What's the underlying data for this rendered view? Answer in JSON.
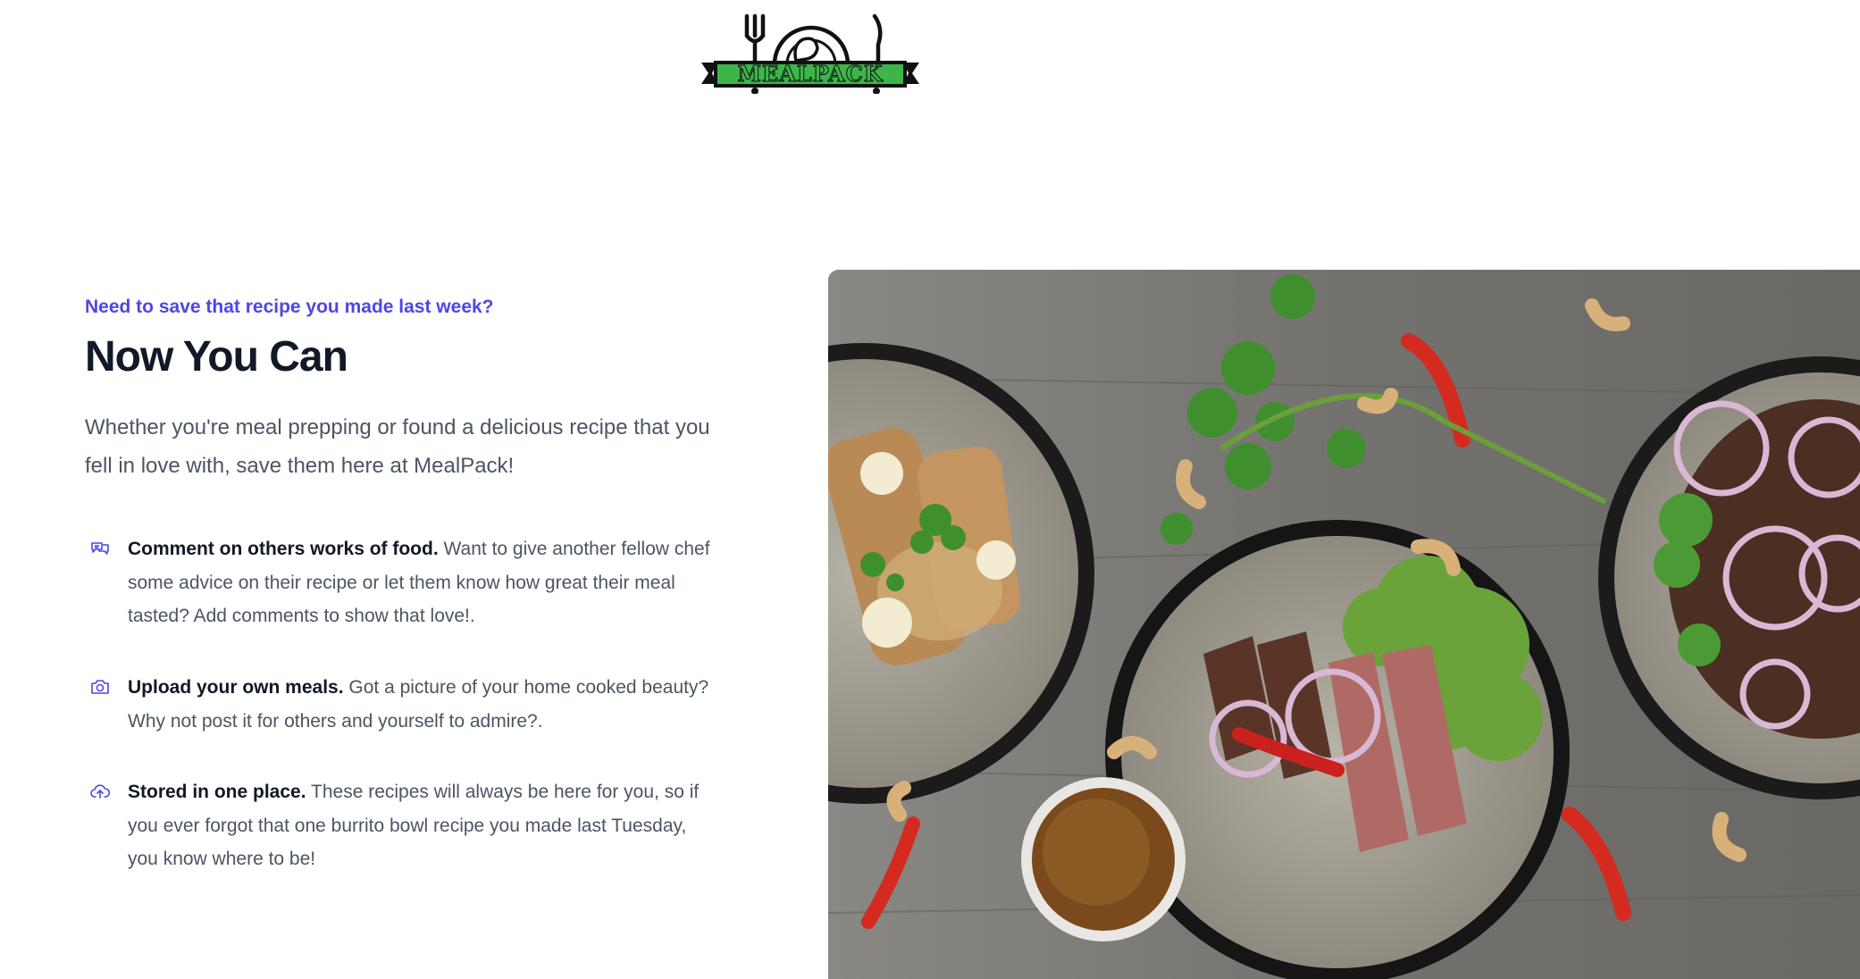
{
  "brand": {
    "name": "MEALPACK"
  },
  "hero": {
    "eyebrow": "Need to save that recipe you made last week?",
    "title": "Now You Can",
    "lead": "Whether you're meal prepping or found a delicious recipe that you fell in love with, save them here at MealPack!"
  },
  "features": [
    {
      "icon": "chat-bubbles-icon",
      "heading": "Comment on others works of food.",
      "text": "Want to give another fellow chef some advice on their recipe or let them know how great their meal tasted? Add comments to show that love!."
    },
    {
      "icon": "camera-icon",
      "heading": "Upload your own meals.",
      "text": "Got a picture of your home cooked beauty? Why not post it for others and yourself to admire?."
    },
    {
      "icon": "cloud-upload-icon",
      "heading": "Stored in one place.",
      "text": "These recipes will always be here for you, so if you ever forgot that one burrito bowl recipe you made last Tuesday, you know where to be!"
    }
  ],
  "colors": {
    "accent": "#4f46e5",
    "logo_green": "#3db54a",
    "heading": "#111827",
    "body_text": "#4b5563"
  }
}
